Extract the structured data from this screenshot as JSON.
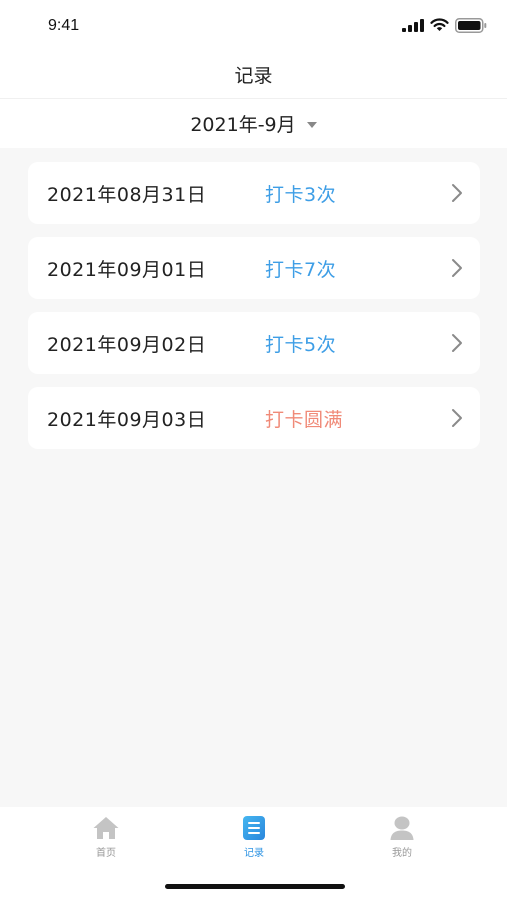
{
  "status_bar": {
    "time": "9:41",
    "icons": [
      "signal-icon",
      "wifi-icon",
      "battery-icon"
    ]
  },
  "header": {
    "title": "记录"
  },
  "month_selector": {
    "label": "2021年-9月",
    "icon": "caret-down-icon"
  },
  "records": [
    {
      "date": "2021年08月31日",
      "status": "打卡3次",
      "status_color": "#3e9ee6"
    },
    {
      "date": "2021年09月01日",
      "status": "打卡7次",
      "status_color": "#3e9ee6"
    },
    {
      "date": "2021年09月02日",
      "status": "打卡5次",
      "status_color": "#3e9ee6"
    },
    {
      "date": "2021年09月03日",
      "status": "打卡圆满",
      "status_color": "#f08a78"
    }
  ],
  "tab_bar": {
    "tabs": [
      {
        "label": "首页",
        "icon": "home-icon",
        "active": false
      },
      {
        "label": "记录",
        "icon": "record-icon",
        "active": true
      },
      {
        "label": "我的",
        "icon": "user-icon",
        "active": false
      }
    ]
  },
  "colors": {
    "accent": "#2f94e3",
    "complete": "#f08a78",
    "background": "#f7f7f7"
  }
}
